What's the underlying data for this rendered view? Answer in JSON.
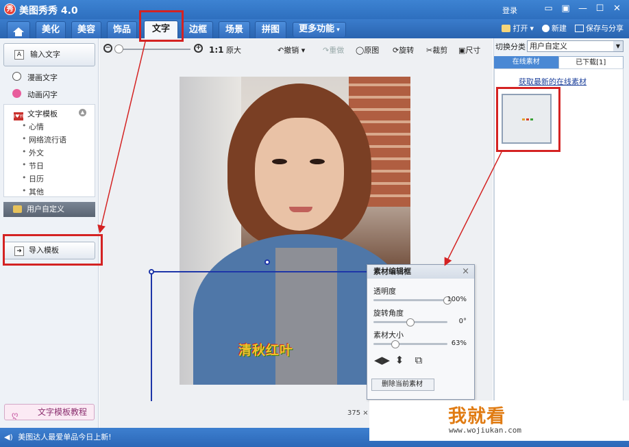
{
  "app": {
    "logo_char": "秀",
    "title": "美图秀秀 4.0",
    "login": "登录"
  },
  "window_controls": [
    "☐",
    "▣",
    "—",
    "☐",
    "✕"
  ],
  "tabs": [
    {
      "label": "美化"
    },
    {
      "label": "美容"
    },
    {
      "label": "饰品"
    },
    {
      "label": "文字",
      "active": true
    },
    {
      "label": "边框"
    },
    {
      "label": "场景"
    },
    {
      "label": "拼图"
    },
    {
      "label": "更多功能"
    }
  ],
  "top_actions": {
    "open": "打开",
    "new": "新建",
    "save_share": "保存与分享"
  },
  "left_panel": {
    "input_text": "输入文字",
    "comic_text": "漫画文字",
    "animated_text": "动画闪字",
    "template_head": "文字模板",
    "template_badge": "I♥YOU",
    "template_items": [
      "心情",
      "网络流行语",
      "外文",
      "节日",
      "日历",
      "其他"
    ],
    "user_defined": "用户自定义",
    "import_template": "导入模板",
    "tutorial": "文字模板教程"
  },
  "toolbar": {
    "ratio": "1:1",
    "original_size": "原大",
    "undo": "撤销",
    "redo": "重做",
    "original_image": "原图",
    "rotate": "旋转",
    "crop": "裁剪",
    "size": "尺寸",
    "zoom_level": 0.0
  },
  "canvas": {
    "photo_text": "清秋红叶",
    "image_width_label": "375 ×"
  },
  "editor": {
    "title": "素材编辑框",
    "close": "×",
    "opacity_label": "透明度",
    "opacity_value": "100%",
    "opacity": 1.0,
    "rotation_label": "旋转角度",
    "rotation_value": "0°",
    "rotation": 0.5,
    "size_label": "素材大小",
    "size_value": "63%",
    "size": 0.3,
    "delete_button": "删除当前素材"
  },
  "right_panel": {
    "switch_label": "切换分类",
    "category": "用户自定义",
    "tab_online": "在线素材",
    "tab_downloaded": "已下载[1]",
    "fetch_link": "获取最新的在线素材"
  },
  "status": {
    "message": "美图达人最爱单品今日上新!"
  },
  "watermark": {
    "title": "我就看",
    "url": "www.wojiukan.com"
  },
  "colors": {
    "annotation_red": "#d42222",
    "selection_blue": "#1d35a8",
    "title_blue": "#2e6fbf"
  }
}
